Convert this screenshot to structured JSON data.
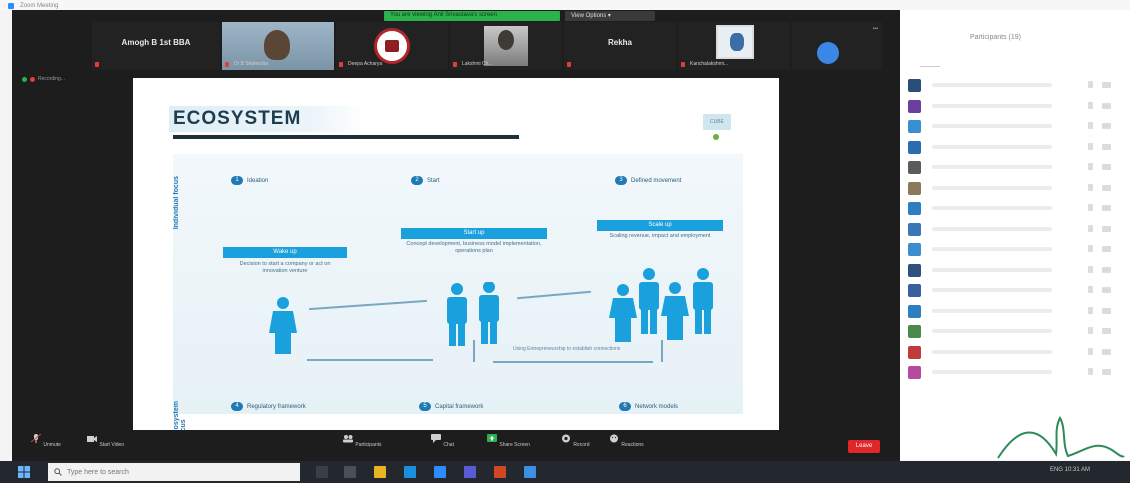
{
  "app": {
    "title": "Zoom Meeting"
  },
  "topbar": {
    "share_banner": "You are viewing Anil Srivastava's screen",
    "view_options": "View Options ▾"
  },
  "participants_strip": [
    {
      "name": "Amogh B 1st BBA",
      "caption": ""
    },
    {
      "name": "",
      "caption": "Dr B Shalendra"
    },
    {
      "name": "",
      "caption": "Deepa Acharya"
    },
    {
      "name": "",
      "caption": "Lakshmi Ch..."
    },
    {
      "name": "Rekha",
      "caption": ""
    },
    {
      "name": "",
      "caption": "Kanchalakshmi..."
    },
    {
      "name": "",
      "caption": ""
    }
  ],
  "recording": {
    "label": "Recording..."
  },
  "slide": {
    "title": "ECOSYSTEM",
    "logo_text": "CUBE",
    "individual_label": "Individual focus",
    "ecosystem_label": "Ecosystem focus",
    "stages_top": [
      {
        "num": "1",
        "label": "Ideation"
      },
      {
        "num": "2",
        "label": "Start"
      },
      {
        "num": "3",
        "label": "Defined movement"
      }
    ],
    "heads": [
      {
        "label": "Wake up",
        "desc": "Decision to start a company or act on innovation venture"
      },
      {
        "label": "Start up",
        "desc": "Concept development, business model implementation, operations plan"
      },
      {
        "label": "Scale up",
        "desc": "Scaling revenue, impact and employment"
      }
    ],
    "feedback_note": "Using Entrepreneurship to establish connections",
    "stages_bottom": [
      {
        "num": "4",
        "label": "Regulatory framework"
      },
      {
        "num": "5",
        "label": "Capital framework"
      },
      {
        "num": "6",
        "label": "Network models"
      }
    ]
  },
  "controls": [
    {
      "label": "Unmute",
      "icon": "mic-icon"
    },
    {
      "label": "Start Video",
      "icon": "video-icon"
    },
    {
      "label": "Participants",
      "icon": "participants-icon"
    },
    {
      "label": "Chat",
      "icon": "chat-icon"
    },
    {
      "label": "Share Screen",
      "icon": "share-icon"
    },
    {
      "label": "Record",
      "icon": "record-icon"
    },
    {
      "label": "Reactions",
      "icon": "reactions-icon"
    }
  ],
  "end_label": "Leave",
  "panel": {
    "title": "Participants (19)",
    "avatar_colors": [
      "#2b4d7a",
      "#6b3fa0",
      "#3a8fd1",
      "#2b6cb0",
      "#5b5b5b",
      "#8a7a5a",
      "#2d7fc1",
      "#3b77b8",
      "#3a8fd1",
      "#2f4f7f",
      "#3a5fa0",
      "#2d7fc1",
      "#4a8a4a",
      "#c23b3b",
      "#b54aa0"
    ]
  },
  "taskbar": {
    "search_placeholder": "Type here to search",
    "tray": "ENG 10:31 AM"
  },
  "colors": {
    "accent": "#1aa0dc",
    "zoom_bg": "#1d1d1d",
    "leave": "#e02828",
    "share_green": "#2bb24c"
  }
}
